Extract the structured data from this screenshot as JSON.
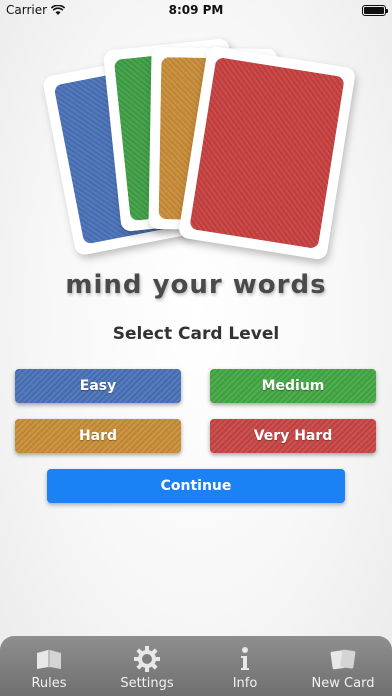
{
  "status_bar": {
    "carrier": "Carrier",
    "time": "8:09 PM"
  },
  "cards": {
    "colors": [
      "#4a72b8",
      "#3f9f45",
      "#c88c38",
      "#c74040"
    ]
  },
  "app_title": "mind your words",
  "level_section": {
    "title": "Select Card Level",
    "levels": [
      {
        "label": "Easy",
        "color": "#4a72b8"
      },
      {
        "label": "Medium",
        "color": "#43a843"
      },
      {
        "label": "Hard",
        "color": "#c98e38"
      },
      {
        "label": "Very Hard",
        "color": "#c84545"
      }
    ],
    "continue_label": "Continue",
    "continue_color": "#1a82f5"
  },
  "tab_bar": {
    "items": [
      {
        "label": "Rules",
        "icon": "book-icon"
      },
      {
        "label": "Settings",
        "icon": "gear-icon"
      },
      {
        "label": "Info",
        "icon": "info-icon"
      },
      {
        "label": "New Card",
        "icon": "cards-icon"
      }
    ]
  }
}
